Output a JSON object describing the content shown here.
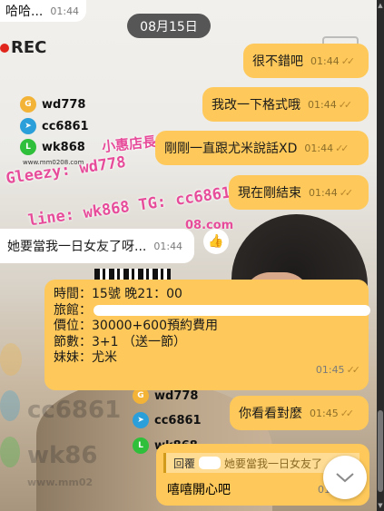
{
  "date_divider": "08月15日",
  "messages": {
    "top_partial": {
      "text": "哈哈...",
      "time": "01:44"
    },
    "m1": {
      "text": "很不錯吧",
      "time": "01:44"
    },
    "m2": {
      "text": "我改一下格式哦",
      "time": "01:44"
    },
    "m3": {
      "text": "剛剛一直跟尤米說話XD",
      "time": "01:44"
    },
    "m4": {
      "text": "現在剛結束",
      "time": "01:44"
    },
    "incoming": {
      "text": "她要當我一日女友了呀...",
      "time": "01:44",
      "reaction": "👍"
    },
    "booking": {
      "time_line": "時間：15號 晚21：00",
      "hotel_label": "旅館：",
      "price_line": "價位：30000+600預約費用",
      "sessions_line": "節數：3+1 （送一節）",
      "girl_line": "妹妹：尤米",
      "time": "01:45"
    },
    "m5": {
      "text": "你看看對麼",
      "time": "01:45"
    },
    "reply": {
      "label": "回覆",
      "quoted": "她要當我一日女友了",
      "text": "嘻嘻開心吧",
      "time": "01:4"
    }
  },
  "background": {
    "rec": "REC",
    "contacts": [
      {
        "icon": "gleezy-icon",
        "label": "wd778"
      },
      {
        "icon": "telegram-icon",
        "label": "cc6861"
      },
      {
        "icon": "line-icon",
        "label": "wk868"
      }
    ],
    "tiny_url": "www.mm0208.com",
    "watermark_shop": "小惠店長",
    "watermark_gleezy": "Gleezy: wd778",
    "watermark_line": "line: wk868  TG: cc6861",
    "watermark_url": "08.com",
    "faint_cc": "cc6861",
    "faint_wk": "wk86",
    "faint_url": "www.mm02",
    "lower_contacts": [
      {
        "icon": "gleezy-icon",
        "label": "wd778"
      },
      {
        "icon": "telegram-icon",
        "label": "cc6861"
      },
      {
        "icon": "line-icon",
        "label": "wk868"
      }
    ]
  },
  "icons": {
    "scroll_down": "chevron-down-icon",
    "read": "double-check-icon"
  },
  "colors": {
    "outgoing": "#fec95a",
    "incoming": "#ffffff",
    "date_pill": "#565656"
  }
}
